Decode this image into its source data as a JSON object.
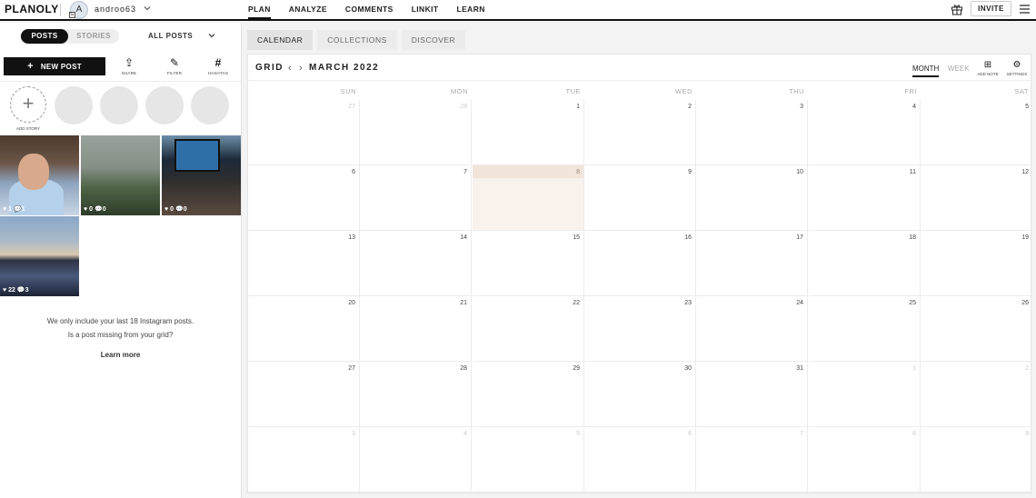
{
  "app": {
    "logo": "PLANOLY"
  },
  "user": {
    "initial": "A",
    "username": "androo63",
    "badge": "G"
  },
  "nav": {
    "items": [
      "PLAN",
      "ANALYZE",
      "COMMENTS",
      "LINKIT",
      "LEARN"
    ],
    "active": "PLAN"
  },
  "topright": {
    "invite_label": "INVITE"
  },
  "left": {
    "toggle": {
      "posts": "POSTS",
      "stories": "STORIES",
      "active": "POSTS"
    },
    "filter_dropdown": "ALL POSTS",
    "new_post_label": "NEW POST",
    "tools": [
      {
        "label": "SHARE",
        "icon": "share-icon",
        "glyph": "⇪"
      },
      {
        "label": "FILTER",
        "icon": "magic-wand-icon",
        "glyph": "✎"
      },
      {
        "label": "HASHTAG",
        "icon": "hashtag-icon",
        "glyph": "#"
      }
    ],
    "add_story_label": "ADD STORY",
    "posts": [
      {
        "likes": "1",
        "comments": "1"
      },
      {
        "likes": "0",
        "comments": "0"
      },
      {
        "likes": "0",
        "comments": "0"
      },
      {
        "likes": "22",
        "comments": "3"
      }
    ],
    "info_line1": "We only include your last 18 Instagram posts.",
    "info_line2": "Is a post missing from your grid?",
    "learn_more": "Learn more"
  },
  "tabs": {
    "items": [
      "CALENDAR",
      "COLLECTIONS",
      "DISCOVER"
    ],
    "active": "CALENDAR"
  },
  "calendar": {
    "grid_label": "GRID",
    "month_title": "MARCH 2022",
    "view_month": "MONTH",
    "view_week": "WEEK",
    "add_note_label": "ADD NOTE",
    "settings_label": "SETTINGS",
    "weekdays": [
      "SUN",
      "MON",
      "TUE",
      "WED",
      "THU",
      "FRI",
      "SAT"
    ],
    "today": "8",
    "weeks": [
      [
        "27",
        "28",
        "1",
        "2",
        "3",
        "4",
        "5"
      ],
      [
        "6",
        "7",
        "8",
        "9",
        "10",
        "11",
        "12"
      ],
      [
        "13",
        "14",
        "15",
        "16",
        "17",
        "18",
        "19"
      ],
      [
        "20",
        "21",
        "22",
        "23",
        "24",
        "25",
        "26"
      ],
      [
        "27",
        "28",
        "29",
        "30",
        "31",
        "1",
        "2"
      ],
      [
        "3",
        "4",
        "5",
        "6",
        "7",
        "8",
        "9"
      ]
    ]
  }
}
